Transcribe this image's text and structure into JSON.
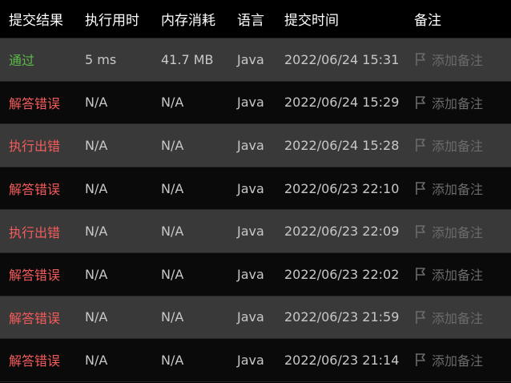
{
  "headers": {
    "status": "提交结果",
    "runtime": "执行用时",
    "memory": "内存消耗",
    "language": "语言",
    "submitted": "提交时间",
    "note": "备注"
  },
  "note_label": "添加备注",
  "colors": {
    "accepted": "#5db84a",
    "error": "#f45c5c"
  },
  "rows": [
    {
      "status": "通过",
      "ok": true,
      "runtime": "5 ms",
      "memory": "41.7 MB",
      "language": "Java",
      "submitted": "2022/06/24 15:31"
    },
    {
      "status": "解答错误",
      "ok": false,
      "runtime": "N/A",
      "memory": "N/A",
      "language": "Java",
      "submitted": "2022/06/24 15:29"
    },
    {
      "status": "执行出错",
      "ok": false,
      "runtime": "N/A",
      "memory": "N/A",
      "language": "Java",
      "submitted": "2022/06/24 15:28"
    },
    {
      "status": "解答错误",
      "ok": false,
      "runtime": "N/A",
      "memory": "N/A",
      "language": "Java",
      "submitted": "2022/06/23 22:10"
    },
    {
      "status": "执行出错",
      "ok": false,
      "runtime": "N/A",
      "memory": "N/A",
      "language": "Java",
      "submitted": "2022/06/23 22:09"
    },
    {
      "status": "解答错误",
      "ok": false,
      "runtime": "N/A",
      "memory": "N/A",
      "language": "Java",
      "submitted": "2022/06/23 22:02"
    },
    {
      "status": "解答错误",
      "ok": false,
      "runtime": "N/A",
      "memory": "N/A",
      "language": "Java",
      "submitted": "2022/06/23 21:59"
    },
    {
      "status": "解答错误",
      "ok": false,
      "runtime": "N/A",
      "memory": "N/A",
      "language": "Java",
      "submitted": "2022/06/23 21:14"
    }
  ]
}
